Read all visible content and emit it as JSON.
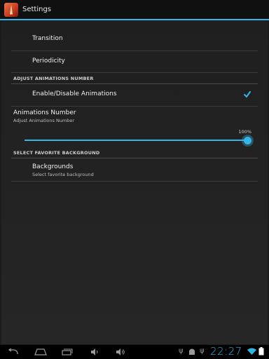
{
  "action_bar": {
    "title": "Settings"
  },
  "preferences": {
    "transition": "Transition",
    "periodicity": "Periodicity",
    "adjust_header": "ADJUST ANIMATIONS NUMBER",
    "enable_animations": {
      "label": "Enable/Disable Animations",
      "checked": true
    },
    "animations_number": {
      "label": "Animations Number",
      "summary": "Adjust Animations Number",
      "value_text": "100%",
      "value": 1.0
    },
    "background_header": "SELECT FAVORITE BACKGROUND",
    "backgrounds": {
      "label": "Backgrounds",
      "summary": "Select favorite background"
    }
  },
  "status_bar": {
    "time": "22:27"
  },
  "icons": [
    "back-icon",
    "home-icon",
    "recents-icon",
    "volume-down-icon",
    "volume-up-icon",
    "usb-icon",
    "android-debug-icon",
    "wifi-icon",
    "battery-icon"
  ],
  "colors": {
    "accent": "#33b5e5",
    "background": "#1b1b1b"
  }
}
